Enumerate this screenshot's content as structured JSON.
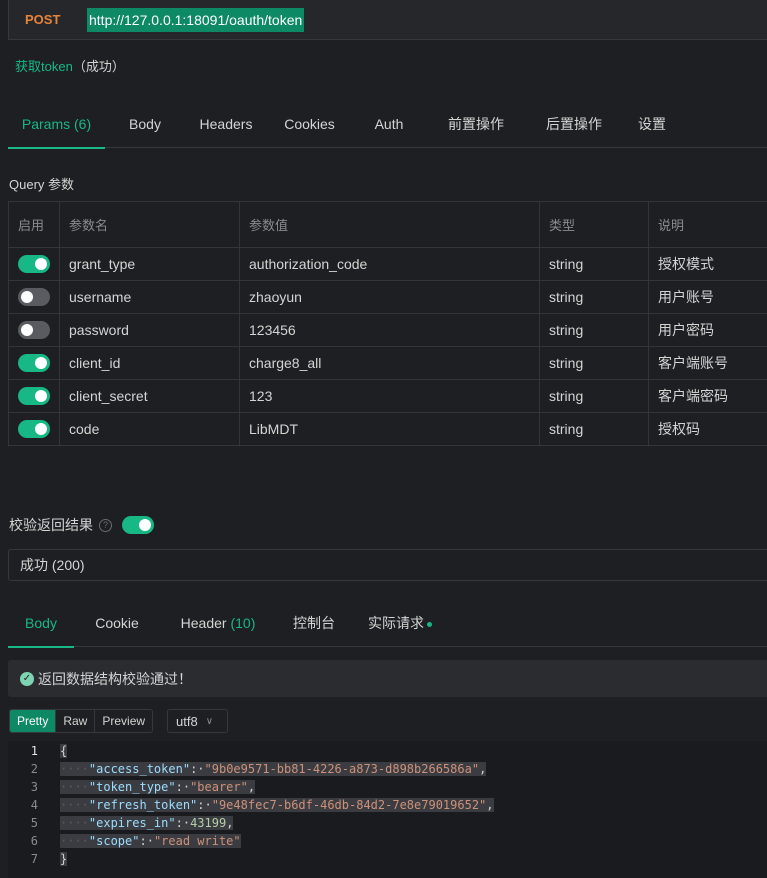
{
  "request": {
    "method": "POST",
    "url": "http://127.0.0.1:18091/oauth/token",
    "name": "获取token",
    "name_status": "（成功）"
  },
  "request_tabs": [
    {
      "label": "Params (6)",
      "active": true
    },
    {
      "label": "Body"
    },
    {
      "label": "Headers"
    },
    {
      "label": "Cookies"
    },
    {
      "label": "Auth"
    },
    {
      "label": "前置操作"
    },
    {
      "label": "后置操作"
    },
    {
      "label": "设置"
    }
  ],
  "query_label": "Query 参数",
  "params_table": {
    "headers": [
      "启用",
      "参数名",
      "参数值",
      "类型",
      "说明"
    ],
    "rows": [
      {
        "enabled": true,
        "name": "grant_type",
        "value": "authorization_code",
        "type": "string",
        "desc": "授权模式"
      },
      {
        "enabled": false,
        "name": "username",
        "value": "zhaoyun",
        "type": "string",
        "desc": "用户账号"
      },
      {
        "enabled": false,
        "name": "password",
        "value": "123456",
        "type": "string",
        "desc": "用户密码"
      },
      {
        "enabled": true,
        "name": "client_id",
        "value": "charge8_all",
        "type": "string",
        "desc": "客户端账号"
      },
      {
        "enabled": true,
        "name": "client_secret",
        "value": "123",
        "type": "string",
        "desc": "客户端密码"
      },
      {
        "enabled": true,
        "name": "code",
        "value": "LibMDT",
        "type": "string",
        "desc": "授权码"
      }
    ]
  },
  "validate": {
    "label": "校验返回结果",
    "enabled": true,
    "help_icon": "question-icon"
  },
  "status": "成功 (200)",
  "response_tabs": [
    {
      "label": "Body",
      "active": true
    },
    {
      "label": "Cookie"
    },
    {
      "label": "Header",
      "count": "(10)"
    },
    {
      "label": "控制台"
    },
    {
      "label": "实际请求",
      "dot": true
    }
  ],
  "validation_message": "返回数据结构校验通过！",
  "view_modes": [
    "Pretty",
    "Raw",
    "Preview"
  ],
  "encoding": "utf8",
  "response_body": {
    "line_numbers": [
      "1",
      "2",
      "3",
      "4",
      "5",
      "6",
      "7"
    ],
    "open_brace": "{",
    "close_brace": "}",
    "fields": [
      {
        "key": "\"access_token\"",
        "value": "\"9b0e9571-bb81-4226-a873-d898b266586a\"",
        "kind": "string"
      },
      {
        "key": "\"token_type\"",
        "value": "\"bearer\"",
        "kind": "string"
      },
      {
        "key": "\"refresh_token\"",
        "value": "\"9e48fec7-b6df-46db-84d2-7e8e79019652\"",
        "kind": "string"
      },
      {
        "key": "\"expires_in\"",
        "value": "43199",
        "kind": "number"
      },
      {
        "key": "\"scope\"",
        "value": "\"read write\"",
        "kind": "string"
      }
    ]
  },
  "colors": {
    "accent": "#17b884",
    "method": "#e8833a",
    "background": "#1e1f22"
  }
}
